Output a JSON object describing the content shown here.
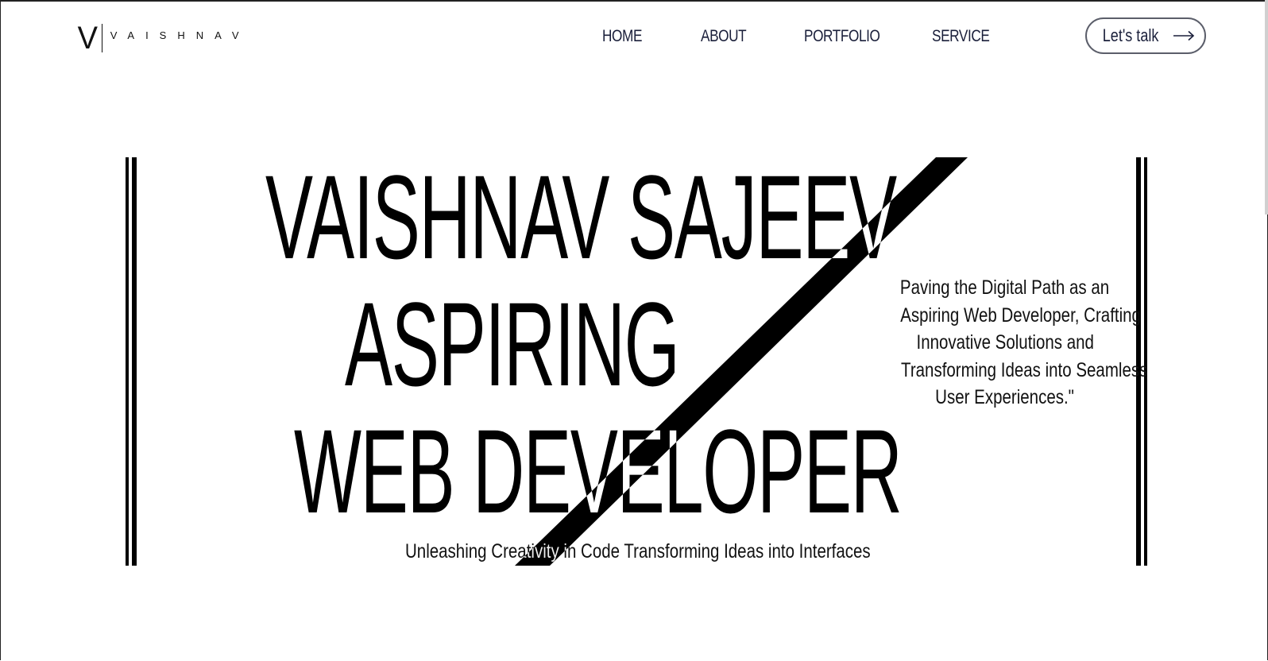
{
  "header": {
    "logo_mark": "V",
    "logo_text": "VAISHNAV",
    "nav": [
      {
        "label": "HOME"
      },
      {
        "label": "ABOUT"
      },
      {
        "label": "PORTFOLIO"
      },
      {
        "label": "SERVICE"
      }
    ],
    "cta_label": "Let's talk"
  },
  "hero": {
    "line1": "VAISHNAV SAJEEV",
    "line2": "ASPIRING",
    "line3": "WEB DEVELOPER",
    "tagline": [
      "Paving the Digital Path as an",
      "Aspiring Web Developer, Crafting",
      "Innovative Solutions and",
      "Transforming Ideas into Seamless",
      "User Experiences.\""
    ],
    "subtitle": "Unleashing Creativity in Code Transforming Ideas into Interfaces"
  },
  "colors": {
    "text": "#000000",
    "nav_text": "#1a1f3a",
    "button_border": "#5b5e6a",
    "background": "#ffffff"
  },
  "icons": {
    "cta": "arrow-right-icon",
    "decoration": "diagonal-slash"
  }
}
